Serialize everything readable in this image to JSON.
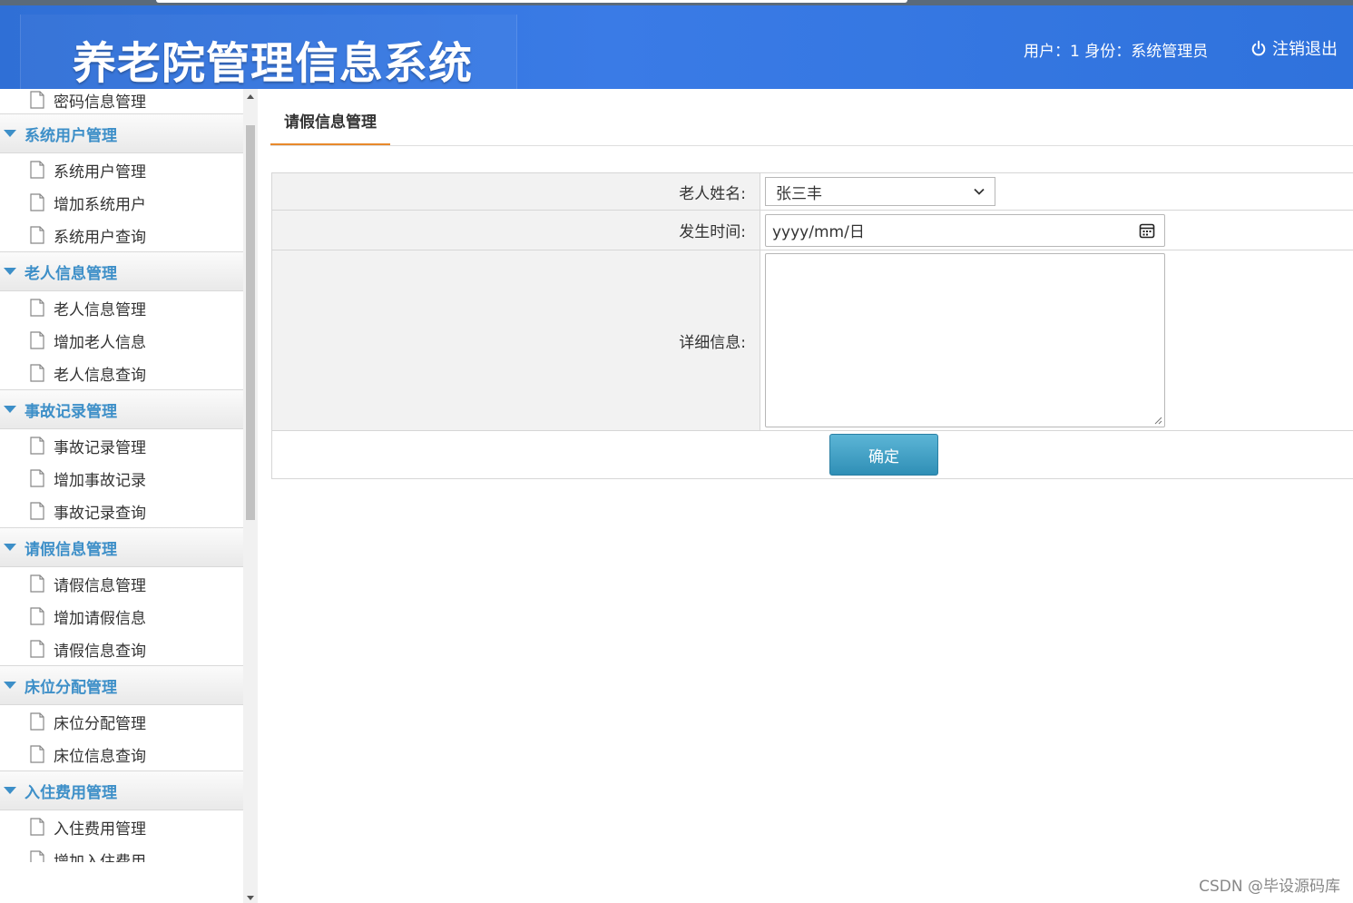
{
  "header": {
    "title": "养老院管理信息系统",
    "user_info": "用户：1 身份：系统管理员",
    "logout_label": "注销退出"
  },
  "sidebar": {
    "top_item": "密码信息管理",
    "groups": [
      {
        "title": "系统用户管理",
        "items": [
          "系统用户管理",
          "增加系统用户",
          "系统用户查询"
        ]
      },
      {
        "title": "老人信息管理",
        "items": [
          "老人信息管理",
          "增加老人信息",
          "老人信息查询"
        ]
      },
      {
        "title": "事故记录管理",
        "items": [
          "事故记录管理",
          "增加事故记录",
          "事故记录查询"
        ]
      },
      {
        "title": "请假信息管理",
        "items": [
          "请假信息管理",
          "增加请假信息",
          "请假信息查询"
        ]
      },
      {
        "title": "床位分配管理",
        "items": [
          "床位分配管理",
          "床位信息查询"
        ]
      },
      {
        "title": "入住费用管理",
        "items": [
          "入住费用管理",
          "增加入住费用"
        ]
      }
    ]
  },
  "main": {
    "tab_label": "请假信息管理",
    "form": {
      "elder_name_label": "老人姓名:",
      "elder_name_value": "张三丰",
      "time_label": "发生时间:",
      "time_placeholder": "yyyy/mm/日",
      "detail_label": "详细信息:",
      "detail_value": "",
      "submit_label": "确定"
    }
  },
  "watermark": "CSDN @毕设源码库",
  "colors": {
    "header_blue": "#3a7be6",
    "sidebar_group_text": "#3d8fc8",
    "tab_underline": "#e8892b",
    "button_blue": "#2f8fb6"
  }
}
